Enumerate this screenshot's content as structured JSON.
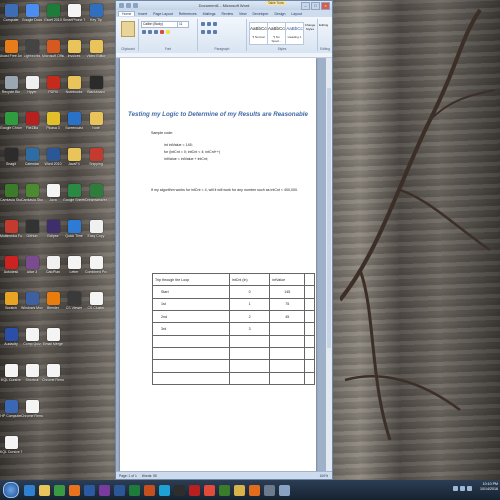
{
  "desktop": {
    "icons_col1": [
      {
        "label": "Computer",
        "color": "#3d6db5",
        "icon": "computer-icon"
      },
      {
        "label": "Avast Free Antivirus",
        "color": "#e87c1a",
        "icon": "avast-icon"
      },
      {
        "label": "Recycle Bin",
        "color": "#9aa6b2",
        "icon": "recycle-bin-icon"
      },
      {
        "label": "Google Chrome",
        "color": "#2f9c3f",
        "icon": "chrome-icon"
      },
      {
        "label": "Snagit",
        "color": "#2c2c2c",
        "icon": "snagit-icon"
      },
      {
        "label": "Camtasia Studio",
        "color": "#3b7c2a",
        "icon": "camtasia-icon"
      },
      {
        "label": "Multimedia Fusion 2",
        "color": "#c23b2e",
        "icon": "mmf-icon"
      },
      {
        "label": "Autodesk",
        "color": "#cc2222",
        "icon": "autodesk-icon"
      },
      {
        "label": "Scratch",
        "color": "#e8a224",
        "icon": "scratch-icon"
      },
      {
        "label": "Audacity",
        "color": "#2a4fa8",
        "icon": "audacity-icon"
      },
      {
        "label": "KQL Cursive",
        "color": "#f4f4f4",
        "icon": "document-icon"
      },
      {
        "label": "HP Computer",
        "color": "#3a68b4",
        "icon": "hp-icon"
      },
      {
        "label": "KQL Cursive Tutor",
        "color": "#f4f4f4",
        "icon": "document-icon"
      }
    ],
    "icons_col2": [
      {
        "label": "Google Docs",
        "color": "#4c8df1",
        "icon": "docs-icon"
      },
      {
        "label": "Lightworks",
        "color": "#444",
        "icon": "lightworks-icon"
      },
      {
        "label": "Hpyer",
        "color": "#f0f0f0",
        "icon": "file-icon"
      },
      {
        "label": "FileZilla",
        "color": "#b81f1f",
        "icon": "filezilla-icon"
      },
      {
        "label": "Calendar",
        "color": "#2e6ca5",
        "icon": "calendar-icon"
      },
      {
        "label": "Camtasia Studio 8",
        "color": "#4c8a30",
        "icon": "camtasia-icon"
      },
      {
        "label": "GitHub",
        "color": "#333",
        "icon": "github-icon"
      },
      {
        "label": "Alice 3",
        "color": "#7a4b8f",
        "icon": "alice-icon"
      },
      {
        "label": "Windows Movie Maker",
        "color": "#3e5fa0",
        "icon": "moviemaker-icon"
      },
      {
        "label": "Comp Quiz",
        "color": "#f4f4f4",
        "icon": "document-icon"
      },
      {
        "label": "Shortcut",
        "color": "#f4f4f4",
        "icon": "document-icon"
      },
      {
        "label": "Chrome Remote",
        "color": "#f4f4f4",
        "icon": "document-icon"
      }
    ],
    "icons_col3": [
      {
        "label": "Excel 2010",
        "color": "#1e7c3a",
        "icon": "excel-icon"
      },
      {
        "label": "Microsoft Office",
        "color": "#d65a1f",
        "icon": "office-icon"
      },
      {
        "label": "PDFill",
        "color": "#c42b1c",
        "icon": "pdf-icon"
      },
      {
        "label": "Picasa 3",
        "color": "#e2c02a",
        "icon": "picasa-icon"
      },
      {
        "label": "Word 2010",
        "color": "#2b5797",
        "icon": "word-icon"
      },
      {
        "label": "Java",
        "color": "#f4f4f4",
        "icon": "java-icon"
      },
      {
        "label": "Eclipse",
        "color": "#3c2f6b",
        "icon": "eclipse-icon"
      },
      {
        "label": "CalcPlan",
        "color": "#f0f0f0",
        "icon": "file-icon"
      },
      {
        "label": "Blender",
        "color": "#e87d0d",
        "icon": "blender-icon"
      },
      {
        "label": "Email Merge",
        "color": "#f4f4f4",
        "icon": "document-icon"
      },
      {
        "label": "Chrome Remote",
        "color": "#f4f4f4",
        "icon": "document-icon"
      }
    ],
    "icons_col4": [
      {
        "label": "SmartPhone Trek",
        "color": "#f4f4f4",
        "icon": "folder-icon"
      },
      {
        "label": "Invoices",
        "color": "#e8c45a",
        "icon": "folder-icon"
      },
      {
        "label": "Notebooks",
        "color": "#e8c45a",
        "icon": "folder-icon"
      },
      {
        "label": "Screencast",
        "color": "#2a71c8",
        "icon": "screencast-icon"
      },
      {
        "label": "JavaFX",
        "color": "#e8c45a",
        "icon": "folder-icon"
      },
      {
        "label": "Google Sheets",
        "color": "#2a8a44",
        "icon": "sheets-icon"
      },
      {
        "label": "Quick Time",
        "color": "#2e7bd6",
        "icon": "quicktime-icon"
      },
      {
        "label": "Letter",
        "color": "#f4f4f4",
        "icon": "document-icon"
      },
      {
        "label": "CS Viewer",
        "color": "#3a3a3a",
        "icon": "viewer-icon"
      }
    ],
    "icons_col5": [
      {
        "label": "Key Tip",
        "color": "#2f6fc0",
        "icon": "app-icon"
      },
      {
        "label": "Video Editor",
        "color": "#e8c45a",
        "icon": "folder-icon"
      },
      {
        "label": "Blackboard",
        "color": "#2b2b2b",
        "icon": "app-icon"
      },
      {
        "label": "Note",
        "color": "#e8c45a",
        "icon": "folder-icon"
      },
      {
        "label": "Snipping",
        "color": "#c23b2e",
        "icon": "app-icon"
      },
      {
        "label": "Dreamweaver",
        "color": "#2f7d3c",
        "icon": "app-icon"
      },
      {
        "label": "Easy Copy",
        "color": "#f0f0f0",
        "icon": "file-icon"
      },
      {
        "label": "Combined Project",
        "color": "#f4f4f4",
        "icon": "document-icon"
      },
      {
        "label": "CS Cluster",
        "color": "#f4f4f4",
        "icon": "document-icon"
      }
    ]
  },
  "word": {
    "window_title": "Document1 - Microsoft Word",
    "table_tools": "Table Tools",
    "tabs": [
      "Home",
      "Insert",
      "Page Layout",
      "References",
      "Mailings",
      "Review",
      "View",
      "Developer",
      "Design",
      "Layout"
    ],
    "font_name": "Calibri (Body)",
    "font_size": "11",
    "groups": [
      "Clipboard",
      "Font",
      "Paragraph",
      "Styles",
      "Editing"
    ],
    "styles": [
      {
        "sample": "AaBbCcDc",
        "name": "¶ Normal"
      },
      {
        "sample": "AaBbCcDc",
        "name": "¶ No Spaci..."
      },
      {
        "sample": "AaBbCc",
        "name": "Heading 1"
      }
    ],
    "change_styles": "Change Styles",
    "editing": "Editing",
    "doc": {
      "title": "Testing my Logic to Determine of my Results are Reasonable",
      "sample_code_label": "Sample code:",
      "code_lines": [
        "int intValue = 145;",
        "for (intCnt = 0; intCnt < 4; intCnt++)",
        "    intValue = intValue + intCnt;"
      ],
      "note": "If my algorithm works for intCnt < 4, will it will work for any number such as intCnt < 400,000.",
      "table": {
        "headers": [
          "Trip through the Loop",
          "intCnt (in)",
          "intValue",
          ""
        ],
        "rows": [
          [
            "Start",
            "0",
            "145",
            ""
          ],
          [
            "1st",
            "1",
            "75",
            ""
          ],
          [
            "2nd",
            "2",
            "45",
            ""
          ],
          [
            "3rd",
            "3",
            "",
            ""
          ],
          [
            "",
            "",
            "",
            ""
          ],
          [
            "",
            "",
            "",
            ""
          ],
          [
            "",
            "",
            "",
            ""
          ],
          [
            "",
            "",
            "",
            ""
          ]
        ]
      }
    },
    "status": {
      "page": "Page: 1 of 1",
      "words": "Words: 55",
      "zoom": "100%"
    }
  },
  "taskbar": {
    "apps": [
      {
        "name": "ie-icon",
        "color": "#2f80d0"
      },
      {
        "name": "explorer-icon",
        "color": "#e8c45a"
      },
      {
        "name": "chrome-icon",
        "color": "#3a9a44"
      },
      {
        "name": "media-icon",
        "color": "#e8731f"
      },
      {
        "name": "photoshop-icon",
        "color": "#2c5aa0"
      },
      {
        "name": "onenote-icon",
        "color": "#7a3b9e"
      },
      {
        "name": "word-icon",
        "color": "#2b5797"
      },
      {
        "name": "excel-icon",
        "color": "#1e7c3a"
      },
      {
        "name": "powerpoint-icon",
        "color": "#c4501f"
      },
      {
        "name": "skype-icon",
        "color": "#1da1d6"
      },
      {
        "name": "snagit-icon",
        "color": "#2d2d2d"
      },
      {
        "name": "filezilla-icon",
        "color": "#b81f1f"
      },
      {
        "name": "paint-icon",
        "color": "#e04b3b"
      },
      {
        "name": "camtasia-icon",
        "color": "#3b7c2a"
      },
      {
        "name": "folder-icon",
        "color": "#d8b24a"
      },
      {
        "name": "media-player-icon",
        "color": "#e06c1c"
      },
      {
        "name": "calculator-icon",
        "color": "#6b7a8c"
      },
      {
        "name": "notepad-icon",
        "color": "#8aa3c3"
      }
    ],
    "time": "10:10 PM",
    "date": "10/14/2016"
  }
}
